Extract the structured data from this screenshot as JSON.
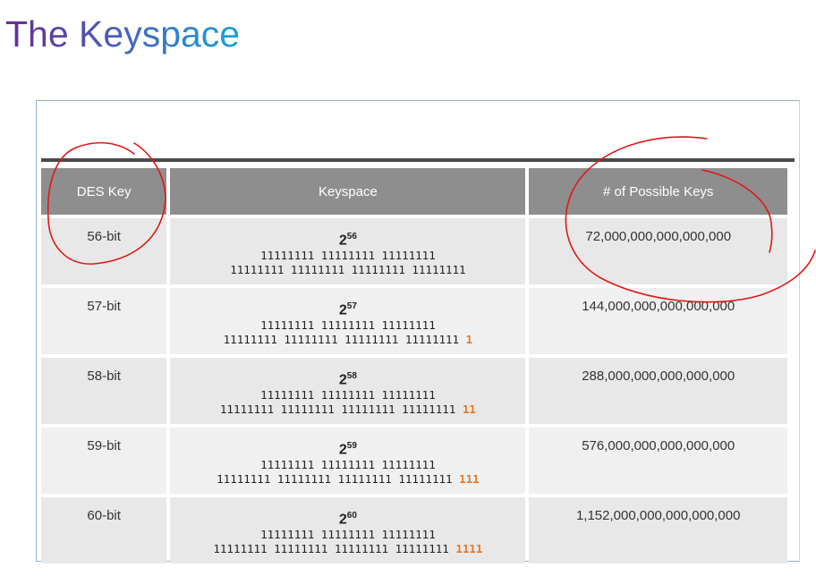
{
  "title": "The Keyspace",
  "table": {
    "headers": {
      "des_key": "DES Key",
      "keyspace": "Keyspace",
      "possible_keys": "# of Possible Keys"
    },
    "rows": [
      {
        "des_key": "56-bit",
        "base": "2",
        "exponent": "56",
        "bits_line1": "11111111 11111111 11111111",
        "bits_line2": "11111111 11111111 11111111 11111111",
        "extra_bits": "",
        "possible_keys": "72,000,000,000,000,000"
      },
      {
        "des_key": "57-bit",
        "base": "2",
        "exponent": "57",
        "bits_line1": "11111111 11111111 11111111",
        "bits_line2": "11111111 11111111 11111111 11111111",
        "extra_bits": "1",
        "possible_keys": "144,000,000,000,000,000"
      },
      {
        "des_key": "58-bit",
        "base": "2",
        "exponent": "58",
        "bits_line1": "11111111 11111111 11111111",
        "bits_line2": "11111111 11111111 11111111 11111111",
        "extra_bits": "11",
        "possible_keys": "288,000,000,000,000,000"
      },
      {
        "des_key": "59-bit",
        "base": "2",
        "exponent": "59",
        "bits_line1": "11111111 11111111 11111111",
        "bits_line2": "11111111 11111111 11111111 11111111",
        "extra_bits": "111",
        "possible_keys": "576,000,000,000,000,000"
      },
      {
        "des_key": "60-bit",
        "base": "2",
        "exponent": "60",
        "bits_line1": "11111111 11111111 11111111",
        "bits_line2": "11111111 11111111 11111111 11111111",
        "extra_bits": "1111",
        "possible_keys": "1,152,000,000,000,000,000"
      }
    ]
  },
  "colors": {
    "header_bg": "#8e8e8e",
    "row_bg": "#e8e8e8",
    "extra_bits": "#e87722",
    "annotation": "#e01818"
  }
}
